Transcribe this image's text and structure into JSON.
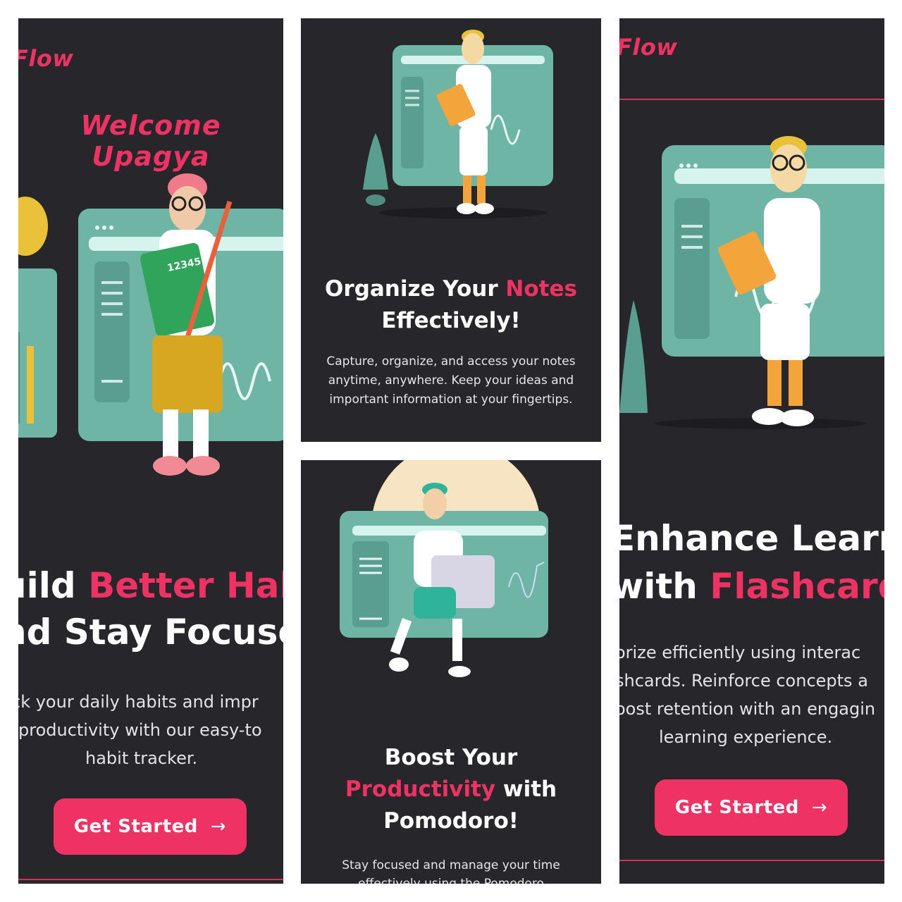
{
  "brand": {
    "name": "Flow",
    "color": "#ee3263"
  },
  "colors": {
    "panel_bg": "#27262a",
    "accent": "#ee3263",
    "teal": "#6fb5a6",
    "text": "#ffffff"
  },
  "screen_left": {
    "welcome": "Welcome Upagya",
    "heading_line1_plain": "uild ",
    "heading_line1_accent": "Better Habi",
    "heading_line2": "nd Stay Focuse",
    "desc_lines": [
      "ck your daily habits and impr",
      "productivity with our easy-to",
      "habit tracker."
    ],
    "cta_label": "Get Started",
    "cta_icon": "arrow-right-icon",
    "calculator_text": "12345"
  },
  "screen_top_center": {
    "title_plain1": "Organize Your ",
    "title_accent": "Notes",
    "title_plain2": "Effectively!",
    "description": "Capture, organize, and access your notes anytime, anywhere. Keep your ideas and important information at your fingertips."
  },
  "screen_bottom_center": {
    "title_line1": "Boost Your",
    "title_accent": "Productivity",
    "title_plain": " with",
    "title_line3": "Pomodoro!",
    "description_line1": "Stay focused and manage your time",
    "description_line2": "effectively using the Pomodoro"
  },
  "screen_right": {
    "heading_line1": "Enhance Learning",
    "heading_line2_plain": "with ",
    "heading_line2_accent": "Flashcards!",
    "desc_lines": [
      "orize efficiently using interac",
      "shcards. Reinforce concepts a",
      "oost retention with an engagin",
      "learning experience."
    ],
    "cta_label": "Get Started",
    "cta_icon": "arrow-right-icon"
  }
}
